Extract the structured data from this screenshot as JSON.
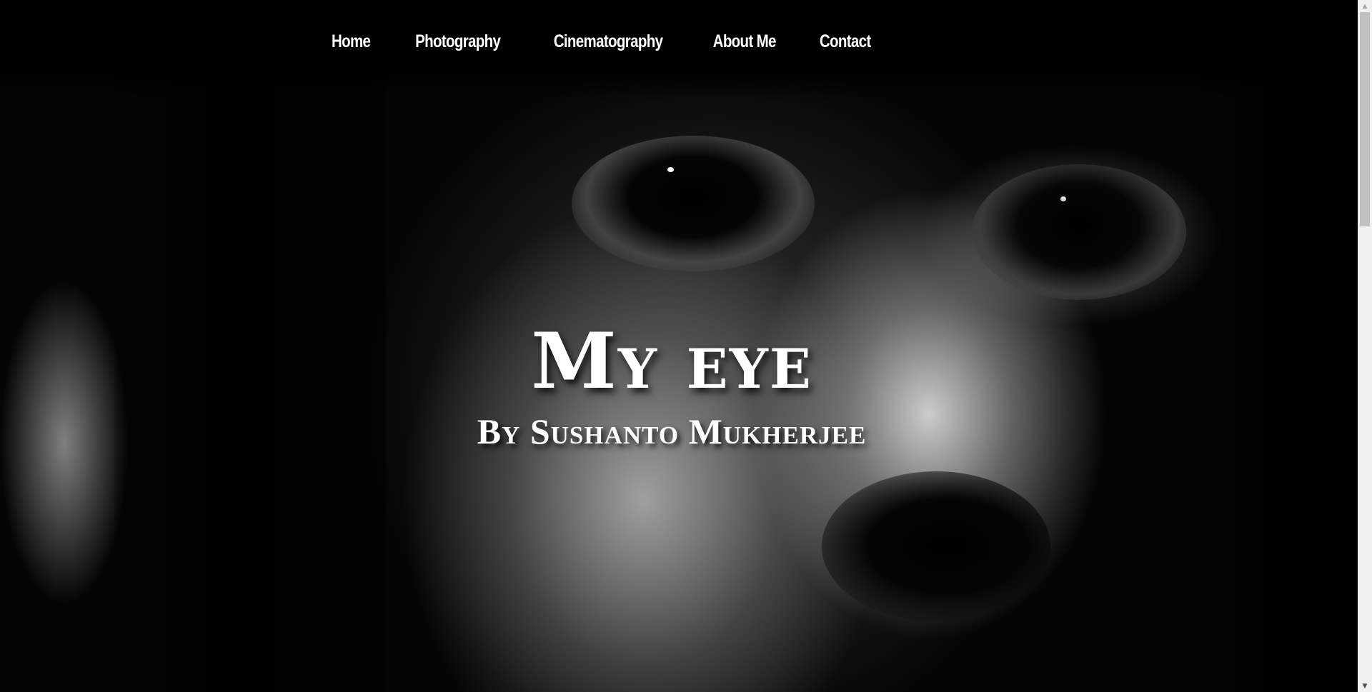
{
  "nav": {
    "items": [
      {
        "label": "Home"
      },
      {
        "label": "Photography"
      },
      {
        "label": "Cinematography"
      },
      {
        "label": "About Me"
      },
      {
        "label": "Contact"
      }
    ]
  },
  "hero": {
    "title": "My eye",
    "subtitle": "By Sushanto Mukherjee",
    "image": "black-and-white close-up portrait of a face"
  },
  "scrollbar": {
    "up_icon": "triangle-up-icon",
    "down_icon": "triangle-down-icon"
  }
}
